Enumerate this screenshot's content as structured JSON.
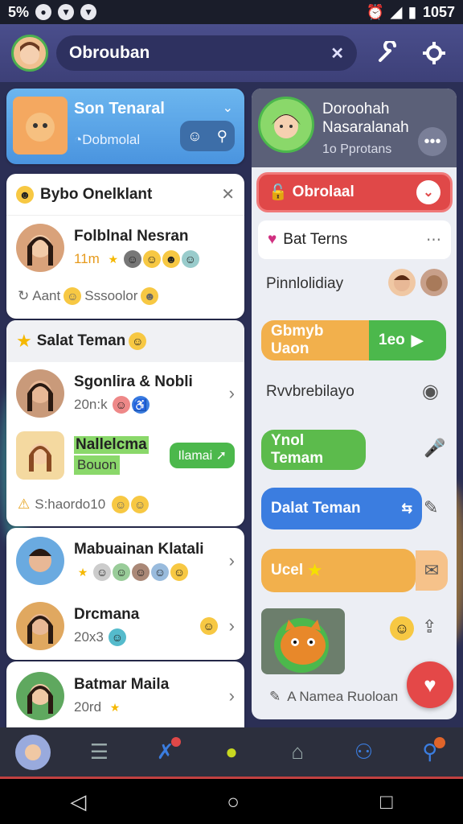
{
  "status_bar": {
    "battery_text": "5%",
    "time": "1057"
  },
  "header": {
    "search_text": "Obrouban",
    "clear_icon": "x-icon",
    "tool_icon": "wrench-icon",
    "settings_icon": "gear-icon"
  },
  "left": {
    "group_card": {
      "title": "Son Tenaral",
      "subtitle": "Dobmolal"
    },
    "suggest_card": {
      "title": "Bybo Onelklant",
      "contact_name": "Folblnal Nesran",
      "contact_meta": "11m",
      "footer_text": "Aant",
      "footer_text2": "Sssoolor"
    },
    "friends_card": {
      "title": "Salat Teman",
      "contact1_name": "Sgonlira & Nobli",
      "contact1_meta": "20n:k",
      "contact2_name": "Nallelcma",
      "contact2_meta": "Bouon",
      "contact2_badge": "Ilamai",
      "footer_text": "S:haordo10"
    },
    "list_card": {
      "contact1_name": "Mabuainan Klatali",
      "contact2_name": "Drcmana",
      "contact2_meta": "20x3"
    },
    "last_card": {
      "contact_name": "Batmar Maila",
      "contact_meta": "20rd"
    }
  },
  "right": {
    "profile": {
      "name_line1": "Doroohah",
      "name_line2": "Nasaralanah",
      "meta": "1o Pprotans"
    },
    "action_button": "Obrolaal",
    "section_title": "Bat Terns",
    "messages": {
      "m1": "Pinnlolidiay",
      "m2": "Gbmyb Uaon",
      "m2_badge": "1eo",
      "m3": "Rvvbrebilayo",
      "m4": "Ynol Temam",
      "m5": "Dalat Teman",
      "m6": "Ucel"
    },
    "compose_hint": "A Namea Ruoloan"
  },
  "nav": {
    "items": [
      "avatar",
      "list-icon",
      "tools-icon",
      "chat-icon",
      "home-icon",
      "profile-icon",
      "search-icon"
    ]
  },
  "colors": {
    "accent_blue": "#3b7de0",
    "accent_red": "#e04848",
    "accent_green": "#4cb84c",
    "accent_orange": "#f2b04c"
  }
}
